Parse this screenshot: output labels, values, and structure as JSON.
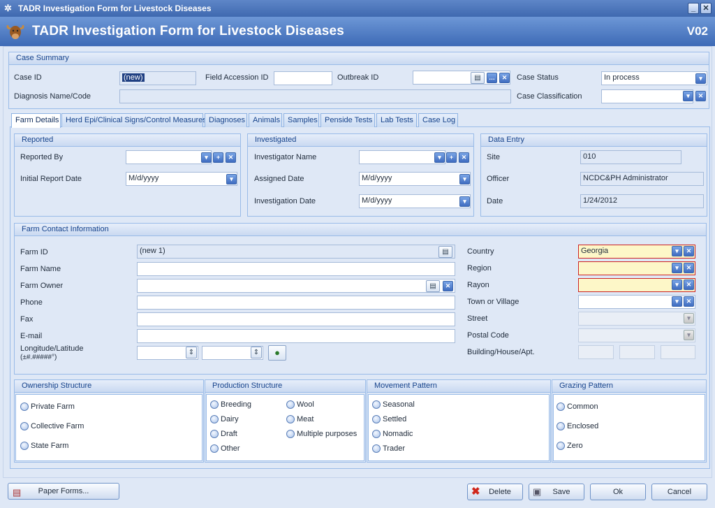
{
  "window": {
    "title": "TADR Investigation Form for Livestock Diseases"
  },
  "header": {
    "title": "TADR Investigation Form for Livestock Diseases",
    "version": "V02"
  },
  "case_summary": {
    "heading": "Case Summary",
    "case_id_label": "Case ID",
    "case_id_value": "(new)",
    "field_accession_label": "Field Accession ID",
    "field_accession_value": "",
    "outbreak_id_label": "Outbreak ID",
    "outbreak_id_value": "",
    "case_status_label": "Case Status",
    "case_status_value": "In process",
    "diagnosis_label": "Diagnosis Name/Code",
    "diagnosis_value": "",
    "case_class_label": "Case Classification",
    "case_class_value": ""
  },
  "tabs": [
    "Farm Details",
    "Herd Epi/Clinical Signs/Control Measures",
    "Diagnoses",
    "Animals",
    "Samples",
    "Penside Tests",
    "Lab Tests",
    "Case Log"
  ],
  "reported": {
    "heading": "Reported",
    "reported_by_label": "Reported By",
    "reported_by_value": "",
    "initial_date_label": "Initial Report Date",
    "initial_date_value": "M/d/yyyy"
  },
  "investigated": {
    "heading": "Investigated",
    "investigator_label": "Investigator Name",
    "investigator_value": "",
    "assigned_label": "Assigned Date",
    "assigned_value": "M/d/yyyy",
    "investigation_label": "Investigation Date",
    "investigation_value": "M/d/yyyy"
  },
  "data_entry": {
    "heading": "Data Entry",
    "site_label": "Site",
    "site_value": "010",
    "officer_label": "Officer",
    "officer_value": "NCDC&PH Administrator",
    "date_label": "Date",
    "date_value": "1/24/2012"
  },
  "farm_contact": {
    "heading": "Farm Contact Information",
    "farm_id_label": "Farm ID",
    "farm_id_value": "(new 1)",
    "farm_name_label": "Farm Name",
    "farm_name_value": "",
    "farm_owner_label": "Farm Owner",
    "farm_owner_value": "",
    "phone_label": "Phone",
    "phone_value": "",
    "fax_label": "Fax",
    "fax_value": "",
    "email_label": "E-mail",
    "email_value": "",
    "lonlat_label": "Longitude/Latitude",
    "lonlat_hint": "(±#.#####°)",
    "lon_value": "",
    "lat_value": "",
    "country_label": "Country",
    "country_value": "Georgia",
    "region_label": "Region",
    "region_value": "",
    "rayon_label": "Rayon",
    "rayon_value": "",
    "town_label": "Town or Village",
    "town_value": "",
    "street_label": "Street",
    "street_value": "",
    "postal_label": "Postal Code",
    "postal_value": "",
    "building_label": "Building/House/Apt."
  },
  "ownership": {
    "heading": "Ownership Structure",
    "options": [
      "Private Farm",
      "Collective Farm",
      "State Farm"
    ]
  },
  "production": {
    "heading": "Production Structure",
    "options": [
      "Breeding",
      "Dairy",
      "Draft",
      "Other",
      "Wool",
      "Meat",
      "Multiple purposes"
    ]
  },
  "movement": {
    "heading": "Movement Pattern",
    "options": [
      "Seasonal",
      "Settled",
      "Nomadic",
      "Trader"
    ]
  },
  "grazing": {
    "heading": "Grazing Pattern",
    "options": [
      "Common",
      "Enclosed",
      "Zero"
    ]
  },
  "buttons": {
    "paper_forms": "Paper Forms...",
    "delete": "Delete",
    "save": "Save",
    "ok": "Ok",
    "cancel": "Cancel"
  },
  "colors": {
    "accent": "#3d6ab6",
    "required_border": "#cc2222",
    "required_fill": "#fdf7c8"
  }
}
